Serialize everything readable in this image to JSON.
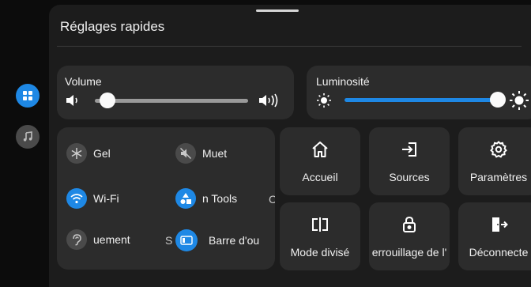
{
  "panel": {
    "title": "Réglages rapides"
  },
  "volume": {
    "label": "Volume",
    "level": 0
  },
  "brightness": {
    "label": "Luminosité",
    "level": 1
  },
  "toggles": {
    "gel": "Gel",
    "muet": "Muet",
    "wifi": "Wi-Fi",
    "tools": "n Tools",
    "tools_next": "C",
    "eco": "uement",
    "eco_next": "S",
    "taskbar": "Barre d'ou"
  },
  "tiles": {
    "home": "Accueil",
    "sources": "Sources",
    "settings": "Paramètres",
    "split": "Mode divisé",
    "lock": "errouillage de l'",
    "logout": "Déconnecte"
  },
  "colors": {
    "accent": "#1e88e5",
    "panel": "#1c1c1c",
    "card": "#2c2c2c",
    "icon_off": "#4a4a4a"
  }
}
